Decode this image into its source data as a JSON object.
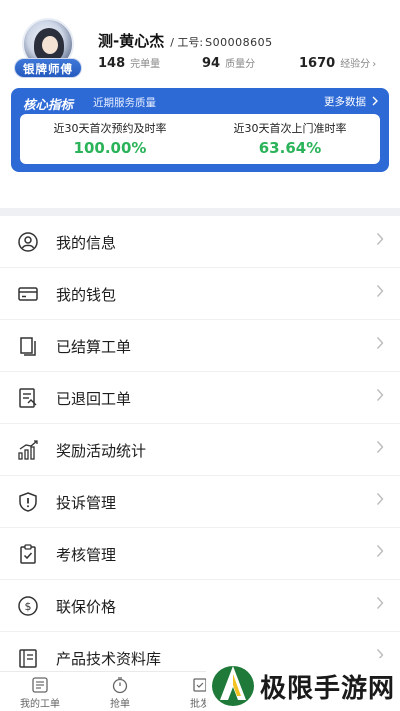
{
  "profile": {
    "badge": "银牌师傅",
    "name": "测-黄心杰",
    "employee_label": "/ 工号:",
    "employee_id": "S00008605",
    "stats": [
      {
        "value": "148",
        "label": "完单量"
      },
      {
        "value": "94",
        "label": "质量分"
      },
      {
        "value": "1670",
        "label": "经验分",
        "arrow": "›"
      }
    ]
  },
  "core": {
    "title": "核心指标",
    "subtitle": "近期服务质量",
    "more": "更多数据",
    "metrics": [
      {
        "label": "近30天首次预约及时率",
        "value": "100.00%"
      },
      {
        "label": "近30天首次上门准时率",
        "value": "63.64%"
      }
    ],
    "value_color": "#2bb35a",
    "card_color": "#2e6ad6"
  },
  "menu": [
    {
      "label": "我的信息",
      "icon": "user-icon"
    },
    {
      "label": "我的钱包",
      "icon": "wallet-icon"
    },
    {
      "label": "已结算工单",
      "icon": "document-icon"
    },
    {
      "label": "已退回工单",
      "icon": "returned-order-icon"
    },
    {
      "label": "奖励活动统计",
      "icon": "bar-chart-icon"
    },
    {
      "label": "投诉管理",
      "icon": "complaint-shield-icon"
    },
    {
      "label": "考核管理",
      "icon": "clipboard-check-icon"
    },
    {
      "label": "联保价格",
      "icon": "dollar-coin-icon"
    },
    {
      "label": "产品技术资料库",
      "icon": "library-icon"
    }
  ],
  "tabs": [
    {
      "label": "我的工单",
      "icon": "list-icon"
    },
    {
      "label": "抢单",
      "icon": "timer-icon"
    },
    {
      "label": "批发",
      "icon": "box-icon"
    }
  ],
  "watermark": {
    "text": "极限手游网"
  }
}
